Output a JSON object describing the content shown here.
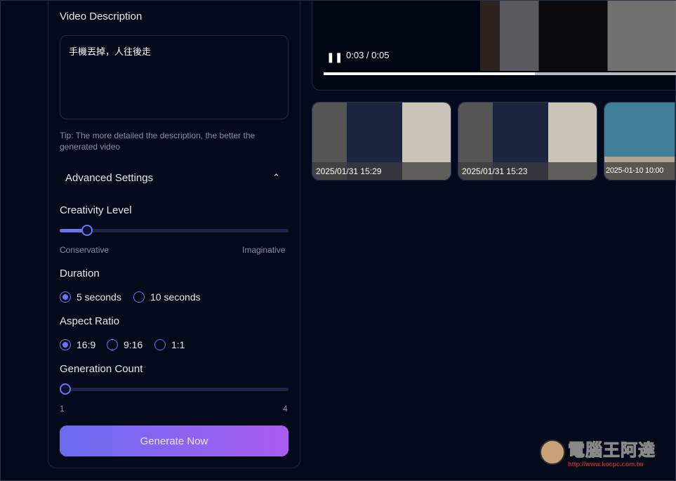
{
  "form": {
    "description_label": "Video Description",
    "description_value": "手機丟掉，人往後走",
    "tip": "Tip: The more detailed the description, the better the generated video",
    "advanced_label": "Advanced Settings",
    "creativity": {
      "label": "Creativity Level",
      "min_label": "Conservative",
      "max_label": "Imaginative",
      "value": 0.12
    },
    "duration": {
      "label": "Duration",
      "options": [
        "5 seconds",
        "10 seconds"
      ],
      "selected": "5 seconds"
    },
    "aspect": {
      "label": "Aspect Ratio",
      "options": [
        "16:9",
        "9:16",
        "1:1"
      ],
      "selected": "16:9"
    },
    "count": {
      "label": "Generation Count",
      "min": "1",
      "max": "4",
      "value": 1
    },
    "generate_label": "Generate Now",
    "accent": "#6b73f5"
  },
  "player": {
    "time": "0:03 / 0:05",
    "progress": 0.6,
    "state": "playing",
    "icon": "pause-icon"
  },
  "history": [
    {
      "caption": "2025/01/31 15:29"
    },
    {
      "caption": "2025/01/31 15:23"
    },
    {
      "caption": "2025-01-10 10:00"
    }
  ],
  "watermark": {
    "title": "電腦王阿達",
    "url": "http://www.kocpc.com.tw"
  }
}
